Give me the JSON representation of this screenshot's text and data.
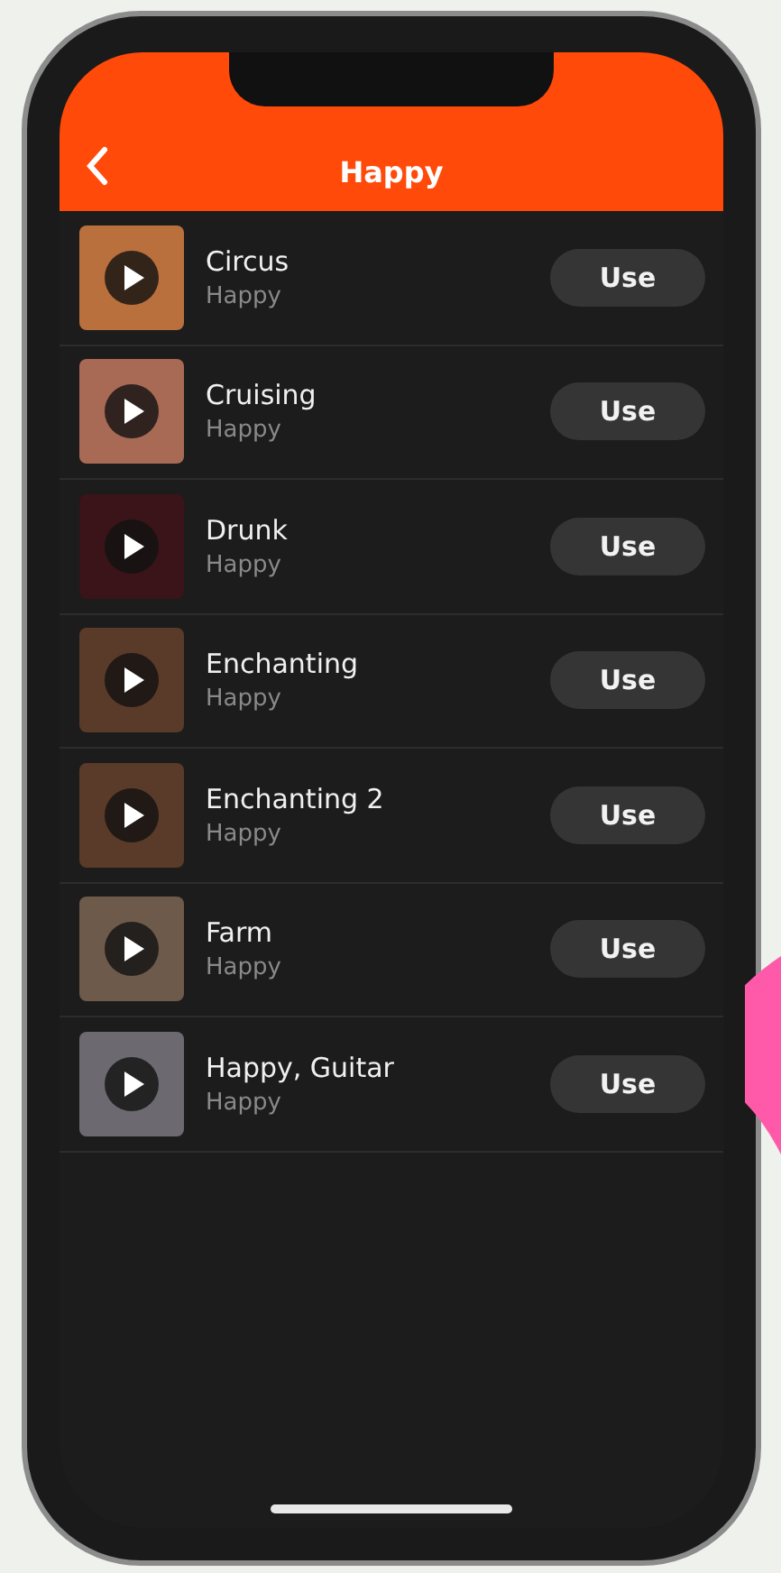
{
  "header": {
    "title": "Happy"
  },
  "tracks": [
    {
      "title": "Circus",
      "subtitle": "Happy",
      "button": "Use"
    },
    {
      "title": "Cruising",
      "subtitle": "Happy",
      "button": "Use"
    },
    {
      "title": "Drunk",
      "subtitle": "Happy",
      "button": "Use"
    },
    {
      "title": "Enchanting",
      "subtitle": "Happy",
      "button": "Use"
    },
    {
      "title": "Enchanting 2",
      "subtitle": "Happy",
      "button": "Use"
    },
    {
      "title": "Farm",
      "subtitle": "Happy",
      "button": "Use"
    },
    {
      "title": "Happy, Guitar",
      "subtitle": "Happy",
      "button": "Use"
    }
  ]
}
